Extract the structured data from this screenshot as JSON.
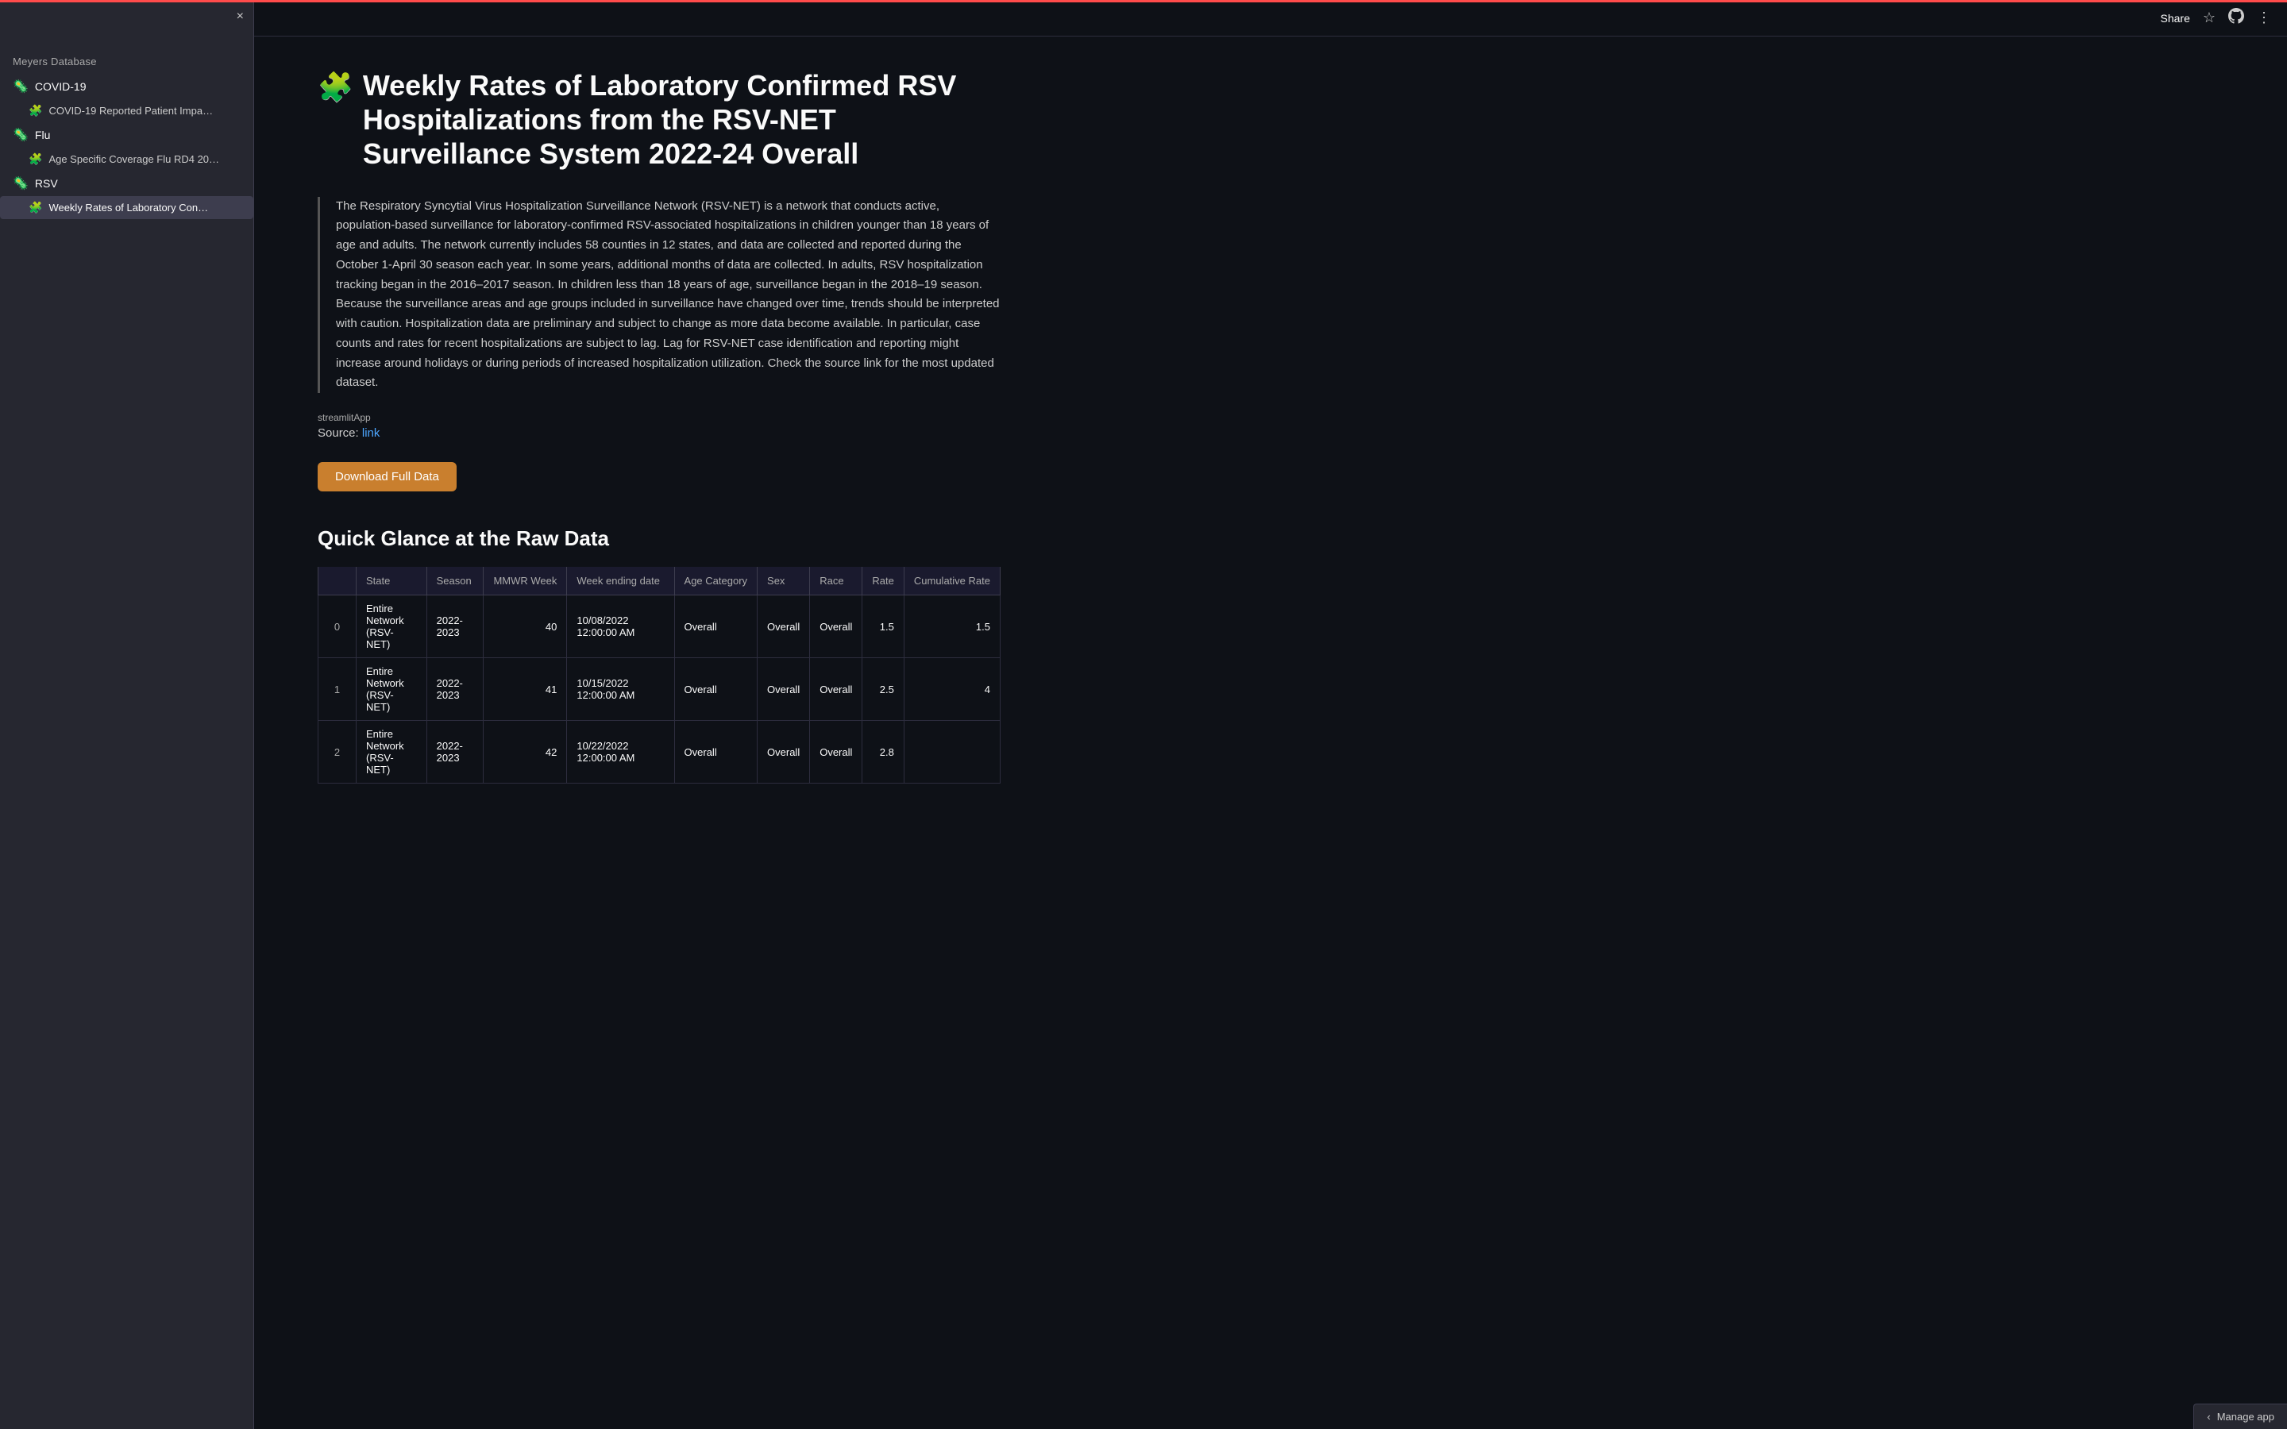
{
  "accent_bar": true,
  "sidebar": {
    "close_icon": "×",
    "section_title": "Meyers Database",
    "categories": [
      {
        "name": "COVID-19",
        "icon": "🦠",
        "items": [
          {
            "label": "COVID-19 Reported Patient Impa…",
            "active": false
          }
        ]
      },
      {
        "name": "Flu",
        "icon": "🦠",
        "items": [
          {
            "label": "Age Specific Coverage Flu RD4 20…",
            "active": false
          }
        ]
      },
      {
        "name": "RSV",
        "icon": "🦠",
        "items": [
          {
            "label": "Weekly Rates of Laboratory Con…",
            "active": true
          }
        ]
      }
    ]
  },
  "topbar": {
    "share_label": "Share",
    "star_icon": "☆",
    "github_icon": "⎇",
    "menu_icon": "⋮"
  },
  "main": {
    "title_icon": "🧩",
    "title": "Weekly Rates of Laboratory Confirmed RSV Hospitalizations from the RSV-NET Surveillance System 2022-24 Overall",
    "description": "The Respiratory Syncytial Virus Hospitalization Surveillance Network (RSV-NET) is a network that conducts active, population-based surveillance for laboratory-confirmed RSV-associated hospitalizations in children younger than 18 years of age and adults. The network currently includes 58 counties in 12 states, and data are collected and reported during the October 1-April 30 season each year. In some years, additional months of data are collected. In adults, RSV hospitalization tracking began in the 2016–2017 season. In children less than 18 years of age, surveillance began in the 2018–19 season. Because the surveillance areas and age groups included in surveillance have changed over time, trends should be interpreted with caution. Hospitalization data are preliminary and subject to change as more data become available. In particular, case counts and rates for recent hospitalizations are subject to lag. Lag for RSV-NET case identification and reporting might increase around holidays or during periods of increased hospitalization utilization. Check the source link for the most updated dataset.",
    "tooltip_label": "streamlitApp",
    "source_label": "Source:",
    "source_link_text": "link",
    "source_link_href": "#",
    "download_button": "Download Full Data",
    "raw_data_title": "Quick Glance at the Raw Data",
    "table": {
      "columns": [
        "",
        "State",
        "Season",
        "MMWR Week",
        "Week ending date",
        "Age Category",
        "Sex",
        "Race",
        "Rate",
        "Cumulative Rate"
      ],
      "rows": [
        {
          "index": 0,
          "state": "Entire Network (RSV-NET)",
          "season": "2022-2023",
          "mmwr_week": 40,
          "week_ending": "10/08/2022 12:00:00 AM",
          "age_category": "Overall",
          "sex": "Overall",
          "race": "Overall",
          "rate": 1.5,
          "cumulative_rate": 1.5
        },
        {
          "index": 1,
          "state": "Entire Network (RSV-NET)",
          "season": "2022-2023",
          "mmwr_week": 41,
          "week_ending": "10/15/2022 12:00:00 AM",
          "age_category": "Overall",
          "sex": "Overall",
          "race": "Overall",
          "rate": 2.5,
          "cumulative_rate": 4
        },
        {
          "index": 2,
          "state": "Entire Network (RSV-NET)",
          "season": "2022-2023",
          "mmwr_week": 42,
          "week_ending": "10/22/2022 12:00:00 AM",
          "age_category": "Overall",
          "sex": "Overall",
          "race": "Overall",
          "rate": 2.8,
          "cumulative_rate": ""
        }
      ]
    }
  },
  "manage_app": {
    "icon": "‹",
    "label": "Manage app"
  }
}
